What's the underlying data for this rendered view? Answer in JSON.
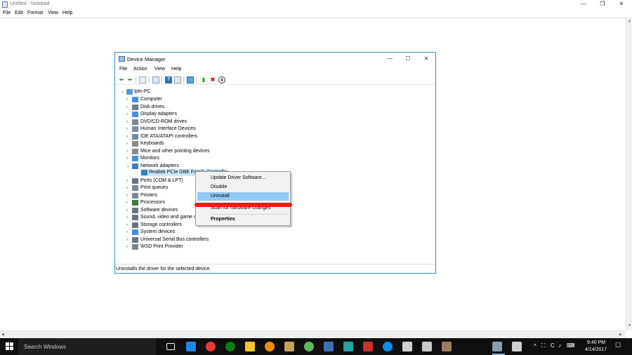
{
  "notepad": {
    "title": "Untitled - Notepad",
    "menu": [
      "File",
      "Edit",
      "Format",
      "View",
      "Help"
    ],
    "caption": {
      "minimize": "—",
      "maximize": "❐",
      "close": "✕"
    }
  },
  "device_manager": {
    "title": "Device Manager",
    "caption": {
      "minimize": "—",
      "maximize": "☐",
      "close": "✕"
    },
    "menu": [
      "File",
      "Action",
      "View",
      "Help"
    ],
    "toolbar": [
      "back-icon",
      "forward-icon",
      "properties-icon",
      "show-hide-icon",
      "help-icon",
      "view-icon",
      "monitor-icon",
      "update-driver-icon",
      "uninstall-icon",
      "scan-hardware-icon"
    ],
    "tree": {
      "root": "tptn-PC",
      "categories": [
        {
          "label": "Computer",
          "icon": "computer-icon",
          "color": "#4a90d9"
        },
        {
          "label": "Disk drives",
          "icon": "disk-drive-icon",
          "color": "#6f7b88"
        },
        {
          "label": "Display adapters",
          "icon": "display-adapter-icon",
          "color": "#4a90d9"
        },
        {
          "label": "DVD/CD-ROM drives",
          "icon": "dvd-drive-icon",
          "color": "#7d8893"
        },
        {
          "label": "Human Interface Devices",
          "icon": "hid-icon",
          "color": "#7c8c9c"
        },
        {
          "label": "IDE ATA/ATAPI controllers",
          "icon": "ide-controller-icon",
          "color": "#6b8aa8"
        },
        {
          "label": "Keyboards",
          "icon": "keyboard-icon",
          "color": "#8a8a8a"
        },
        {
          "label": "Mice and other pointing devices",
          "icon": "mouse-icon",
          "color": "#8a8a8a"
        },
        {
          "label": "Monitors",
          "icon": "monitor-icon",
          "color": "#4a90d9"
        },
        {
          "label": "Network adapters",
          "icon": "network-adapter-icon",
          "color": "#3c7fc1",
          "expanded": true
        },
        {
          "label": "Ports (COM & LPT)",
          "icon": "port-icon",
          "color": "#6b7480"
        },
        {
          "label": "Print queues",
          "icon": "print-queue-icon",
          "color": "#7a8794"
        },
        {
          "label": "Printers",
          "icon": "printer-icon",
          "color": "#7a8794"
        },
        {
          "label": "Processors",
          "icon": "processor-icon",
          "color": "#3b7a3b"
        },
        {
          "label": "Software devices",
          "icon": "software-device-icon",
          "color": "#6b7480"
        },
        {
          "label": "Sound, video and game c",
          "icon": "sound-icon",
          "color": "#6b7480"
        },
        {
          "label": "Storage controllers",
          "icon": "storage-controller-icon",
          "color": "#6b7480"
        },
        {
          "label": "System devices",
          "icon": "system-device-icon",
          "color": "#4a90d9"
        },
        {
          "label": "Universal Serial Bus controllers",
          "icon": "usb-icon",
          "color": "#6b7480"
        },
        {
          "label": "WSD Print Provider",
          "icon": "wsd-printer-icon",
          "color": "#7a8794"
        }
      ],
      "selected_child": "Realtek PCIe GBE Family Controller"
    },
    "status": "Uninstalls the driver for the selected device."
  },
  "context_menu": {
    "items": [
      "Update Driver Software...",
      "Disable",
      "Uninstall",
      "Scan for hardware changes",
      "Properties"
    ],
    "highlighted": "Uninstall",
    "annotation_color": "#ee1c0a"
  },
  "taskbar": {
    "search_placeholder": "Search Windows",
    "apps": [
      {
        "icon": "task-view-icon",
        "color": "#ffffff"
      },
      {
        "icon": "edge-icon",
        "color": "#1e88e5"
      },
      {
        "icon": "chrome-icon",
        "color": "#e53935"
      },
      {
        "icon": "xbox-icon",
        "color": "#107c10"
      },
      {
        "icon": "file-explorer-icon",
        "color": "#f4c430"
      },
      {
        "icon": "app-orange-icon",
        "color": "#f08c00"
      },
      {
        "icon": "app-hand-icon",
        "color": "#c8a060"
      },
      {
        "icon": "app-green-icon",
        "color": "#5cb85c"
      },
      {
        "icon": "app-q-icon",
        "color": "#3a6fb5"
      },
      {
        "icon": "app-teal-icon",
        "color": "#2aa1a1"
      },
      {
        "icon": "filezilla-icon",
        "color": "#c9302c"
      },
      {
        "icon": "teamviewer-icon",
        "color": "#0e8ee9"
      },
      {
        "icon": "app-ca-icon",
        "color": "#d0d0d0"
      },
      {
        "icon": "app-doc-icon",
        "color": "#c8c8c8"
      },
      {
        "icon": "app-tools-icon",
        "color": "#9a7b5a"
      },
      {
        "icon": "device-manager-icon",
        "color": "#8a9cb0"
      },
      {
        "icon": "app-window-icon",
        "color": "#d0d0d0"
      }
    ],
    "time": "9:40 PM",
    "date": "4/14/2017"
  }
}
